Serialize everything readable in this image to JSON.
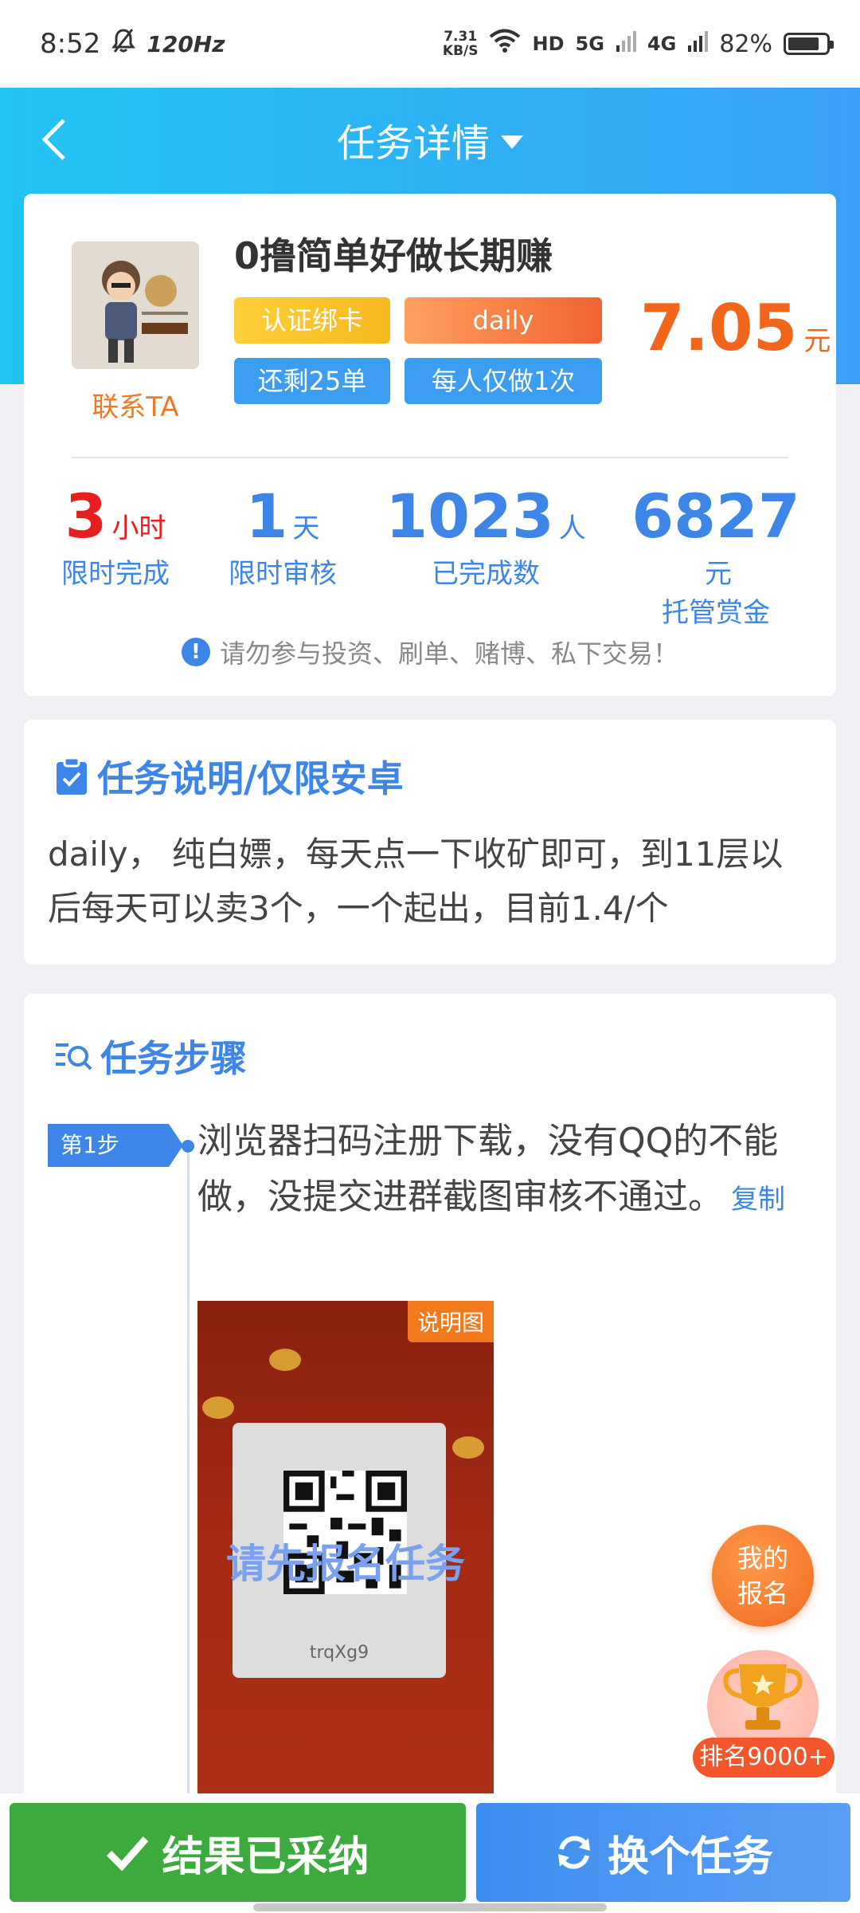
{
  "status_bar": {
    "time": "8:52",
    "refresh_rate": "120Hz",
    "net_speed_value": "7.31",
    "net_speed_unit": "KB/S",
    "hd": "HD",
    "net_5g": "5G",
    "net_4g": "4G",
    "battery": "82%",
    "battery_level": 0.82
  },
  "nav": {
    "title": "任务详情"
  },
  "task": {
    "contact_label": "联系TA",
    "title": "0撸简单好做长期赚",
    "tags": [
      "认证绑卡",
      "daily",
      "还剩25单",
      "每人仅做1次"
    ],
    "price": "7.05",
    "price_unit": "元"
  },
  "stats": [
    {
      "value": "3",
      "unit": "小时",
      "label": "限时完成"
    },
    {
      "value": "1",
      "unit": "天",
      "label": "限时审核"
    },
    {
      "value": "1023",
      "unit": "人",
      "label": "已完成数"
    },
    {
      "value": "6827",
      "unit": "元",
      "label": "托管赏金"
    }
  ],
  "warning": "请勿参与投资、刷单、赌博、私下交易！",
  "description": {
    "title": "任务说明/仅限安卓",
    "text": "daily， 纯白嫖，每天点一下收矿即可，到11层以后每天可以卖3个，一个起出，目前1.4/个"
  },
  "steps": {
    "title": "任务步骤",
    "step1_badge": "第1步",
    "step1_text": "浏览器扫码注册下载，没有QQ的不能做，没提交进群截图审核不通过。",
    "copy_label": "复制",
    "image_label": "说明图",
    "image_overlay": "请先报名任务",
    "qr_caption": "trqXg9"
  },
  "floating": {
    "my_signup_line1": "我的",
    "my_signup_line2": "报名",
    "rank": "排名9000+"
  },
  "actions": {
    "accept": "结果已采纳",
    "switch": "换个任务"
  },
  "colors": {
    "header_start": "#22c4f3",
    "header_end": "#3aa0f5",
    "accent_blue": "#3d86e8",
    "price_orange": "#f2661c",
    "accept_green": "#3caa3c"
  }
}
